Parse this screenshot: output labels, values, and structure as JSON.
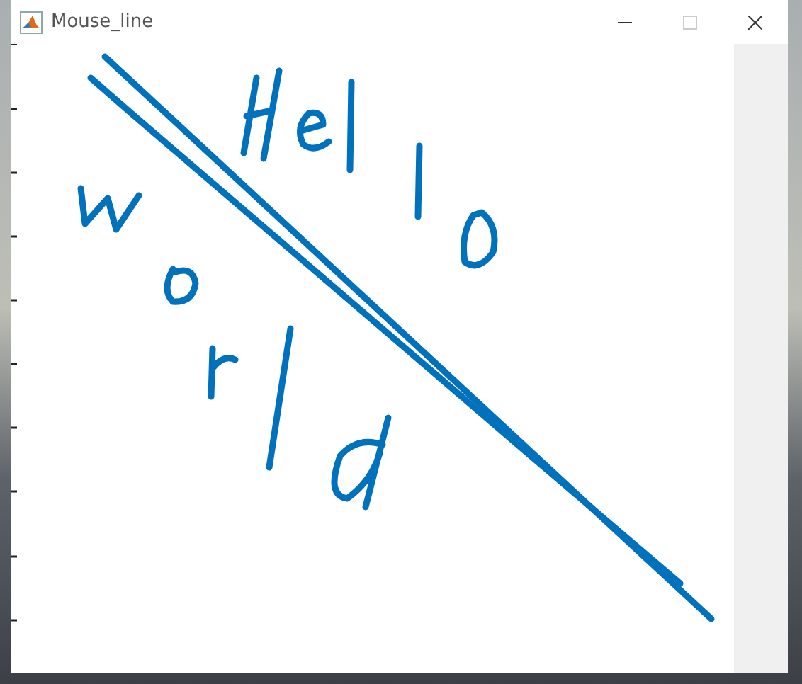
{
  "window": {
    "title": "Mouse_line",
    "controls": [
      {
        "kind": "minimize",
        "disabled": false
      },
      {
        "kind": "maximize",
        "disabled": true
      },
      {
        "kind": "close",
        "disabled": false
      }
    ]
  }
}
